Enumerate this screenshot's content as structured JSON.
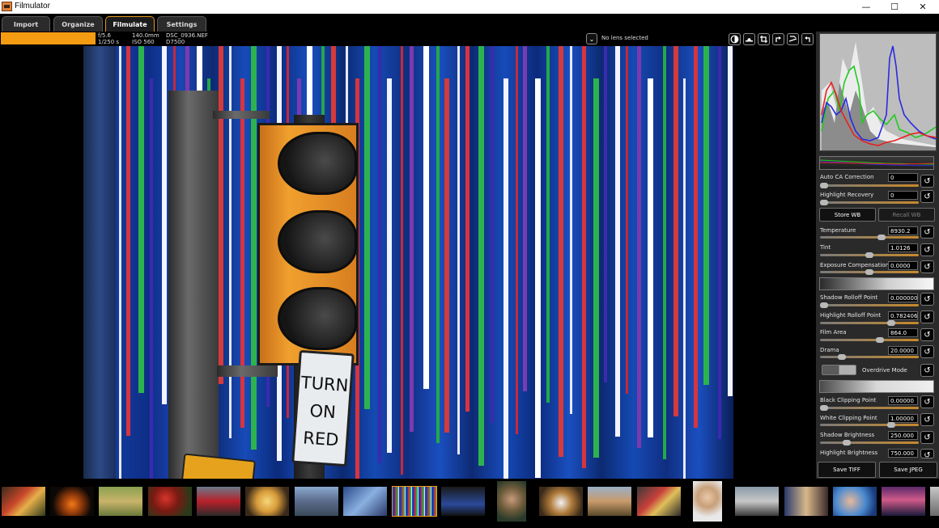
{
  "window": {
    "title": "Filmulator",
    "controls": [
      "—",
      "☐",
      "✕"
    ]
  },
  "tabs": [
    "Import",
    "Organize",
    "Filmulate",
    "Settings"
  ],
  "active_tab": "Filmulate",
  "info": {
    "progress": 1.0,
    "aperture": "f/5.6",
    "shutter": "1/250 s",
    "focal_length": "140.0mm",
    "iso": "ISO 560",
    "filename": "DSC_0936.NEF",
    "camera": "D7500",
    "lens": "No lens selected"
  },
  "photo": {
    "sign_text": [
      "TURN",
      "ON RED"
    ]
  },
  "toolbar": [
    "contrast-icon",
    "hat-icon",
    "crop-icon",
    "rotate-left-icon",
    "leveling-icon",
    "rotate-right-icon"
  ],
  "histogram": {
    "colors": {
      "red": "#e82020",
      "green": "#1fcc1f",
      "blue": "#2a2ae0",
      "luma": "#f2f2f2"
    }
  },
  "controls": {
    "auto_ca": {
      "label": "Auto CA Correction",
      "value": "0",
      "level": 0.0
    },
    "highlight_recovery": {
      "label": "Highlight Recovery",
      "value": "0",
      "level": 0.0
    },
    "store_wb": "Store WB",
    "recall_wb": "Recall WB",
    "temperature": {
      "label": "Temperature",
      "value": "8930.2",
      "level": 0.63
    },
    "tint": {
      "label": "Tint",
      "value": "1.0126",
      "level": 0.5
    },
    "exposure": {
      "label": "Exposure Compensation",
      "value": "0.0000",
      "level": 0.5
    },
    "shadow_rolloff": {
      "label": "Shadow Rolloff Point",
      "value": "0.000000",
      "level": 0.0
    },
    "highlight_rolloff": {
      "label": "Highlight Rolloff Point",
      "value": "0.782406",
      "level": 0.74
    },
    "film_area": {
      "label": "Film Area",
      "value": "864.0",
      "level": 0.62
    },
    "drama": {
      "label": "Drama",
      "value": "20.0000",
      "level": 0.2
    },
    "overdrive": "Overdrive Mode",
    "black_clip": {
      "label": "Black Clipping Point",
      "value": "0.00000",
      "level": 0.0
    },
    "white_clip": {
      "label": "White Clipping Point",
      "value": "1.00000",
      "level": 0.74
    },
    "shadow_brightness": {
      "label": "Shadow Brightness",
      "value": "250.000",
      "level": 0.25
    },
    "highlight_brightness": {
      "label": "Highlight Brightness",
      "value": "750.000",
      "level": 0.74
    },
    "save_tiff": "Save TIFF",
    "save_jpeg": "Save JPEG"
  },
  "accent": "#f39c12"
}
